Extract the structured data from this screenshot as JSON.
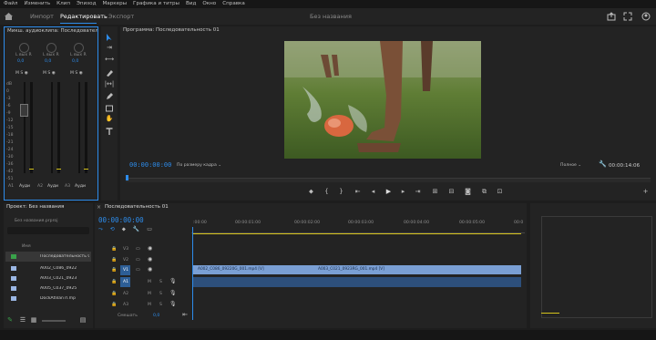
{
  "menu": [
    "Файл",
    "Изменить",
    "Клип",
    "Эпизод",
    "Маркеры",
    "Графика и титры",
    "Вид",
    "Окно",
    "Справка"
  ],
  "workspaces": {
    "import": "Импорт",
    "edit": "Редактировать",
    "export": "Экспорт"
  },
  "project_title": "Без названия",
  "mixer": {
    "title": "Микш. аудиоклипа: Последовательность 01",
    "channels": [
      {
        "pan": "L  вых R",
        "value": "0,0",
        "label": "A1",
        "name": "Ауди"
      },
      {
        "pan": "L  вых R",
        "value": "0,0",
        "label": "A2",
        "name": "Ауди"
      },
      {
        "pan": "L  вых R",
        "value": "0,0",
        "label": "A3",
        "name": "Ауди"
      }
    ],
    "scale": [
      "dB",
      "0",
      "-3",
      "-6",
      "-9",
      "-12",
      "-15",
      "-18",
      "-21",
      "-24",
      "-30",
      "-36",
      "-42",
      "-51"
    ]
  },
  "program": {
    "title": "Программа: Последовательность 01",
    "timecode": "00:00:00:00",
    "fit": "По размеру кадра",
    "quality": "Полное",
    "duration": "00:00:14:06"
  },
  "project": {
    "title": "Проект: Без названия",
    "file": "Без названия.prproj",
    "column": "Имя",
    "items": [
      "Последовательность 01",
      "A002_C086_0922",
      "A003_C021_0923",
      "A005_C037_0925",
      "DockAtlilan7l.mp"
    ]
  },
  "timeline": {
    "tab": "Последовательность 01",
    "timecode": "00:00:00:00",
    "ruler": [
      ":00:00",
      "00:00:01:00",
      "00:00:02:00",
      "00:00:03:00",
      "00:00:04:00",
      "00:00:05:00",
      "00:0"
    ],
    "video_tracks": [
      "V3",
      "V2",
      "V1"
    ],
    "audio_tracks": [
      "A1",
      "A2",
      "A3"
    ],
    "clips": [
      "A002_C086_09220G_001.mp4 [V]",
      "A003_C021_0923RG_001.mp4 [V]"
    ],
    "mix_label": "Смешать",
    "mix_value": "0,0"
  },
  "colors": {
    "accent": "#2d8ceb",
    "clip_video": "#7a9fd4",
    "clip_audio": "#2d4f7b"
  }
}
